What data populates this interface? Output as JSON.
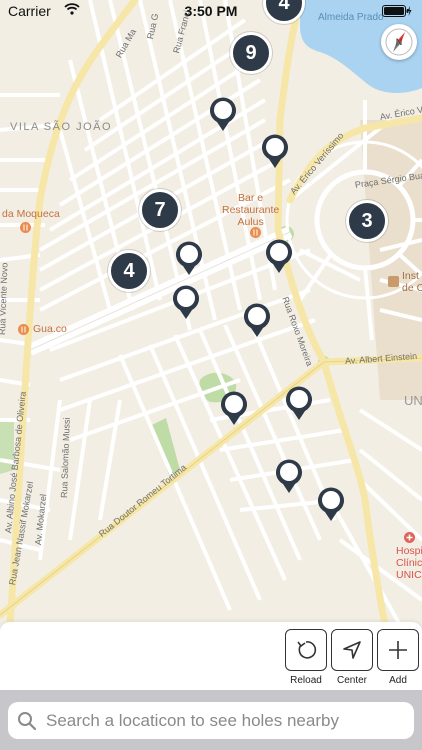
{
  "status_bar": {
    "carrier": "Carrier",
    "time": "3:50 PM"
  },
  "map": {
    "compass_letter": "N",
    "district": "VILA SÃO JOÃO",
    "streets": {
      "albino": "Av. Albino José Barbosa de Oliveira",
      "romeu": "Rua Doutor Romeu Tortima",
      "roxo": "Rua Roxo Moreira",
      "einstein": "Av. Albert Einstein",
      "erico_verissimo": "Av. Érico Veríssimo",
      "erico_top": "Av. Érico Ve",
      "praca": "Praça Sérgio Buarque de Holanda",
      "salomao": "Rua Salomão Mussi",
      "jean": "Rua Jean Nassif Mokarzel",
      "mokarzel": "Av. Mokarzel",
      "vicente": "Rua Vicente Novo",
      "ma": "Rua Ma",
      "gua": "Rua G",
      "franc": "Rua Franci",
      "almeida": "Almeida Prado"
    },
    "places": {
      "moqueca": "da Moqueca",
      "gua_co": "Gua.co",
      "bar_line1": "Bar e",
      "bar_line2": "Restaurante",
      "bar_line3": "Aulus",
      "inst1": "Inst",
      "inst2": "de C",
      "hosp1": "Hospi",
      "hosp2": "Clínic",
      "hosp3": "UNIC",
      "uni": "UNI"
    },
    "clusters": [
      "9",
      "7",
      "4",
      "3",
      "4"
    ],
    "pin_count": 12
  },
  "toolbar": {
    "reload_label": "Reload",
    "center_label": "Center",
    "add_label": "Add"
  },
  "search": {
    "placeholder": "Search a locaticon to see holes nearby"
  },
  "colors": {
    "cluster": "#2e3a48",
    "pin": "#2e3a48",
    "water": "#a9d3f1",
    "road_major": "#f6e7a8"
  }
}
